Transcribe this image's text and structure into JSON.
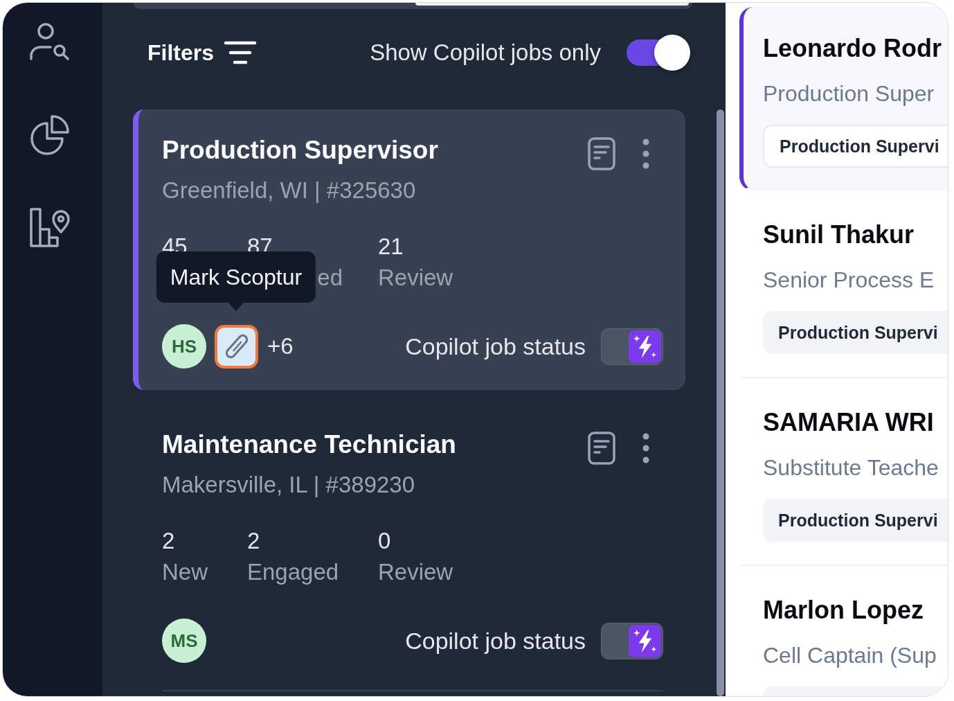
{
  "filters": {
    "label": "Filters",
    "copilot_only_label": "Show Copilot jobs only",
    "copilot_only": true
  },
  "jobs": [
    {
      "title": "Production Supervisor",
      "subtitle": "Greenfield, WI | #325630",
      "selected": true,
      "stats": [
        {
          "value": "45"
        },
        {
          "value": "87",
          "label": "ed",
          "covered": true
        },
        {
          "value": "21",
          "label": "Review"
        }
      ],
      "tooltip": "Mark Scoptur",
      "avatars": [
        {
          "kind": "initials",
          "initials": "HS"
        },
        {
          "kind": "attachment",
          "focused": true
        }
      ],
      "more": "+6",
      "copilot_label": "Copilot job status",
      "copilot_on": true
    },
    {
      "title": "Maintenance Technician",
      "subtitle": "Makersville, IL | #389230",
      "selected": false,
      "stats": [
        {
          "value": "2",
          "label": "New"
        },
        {
          "value": "2",
          "label": "Engaged"
        },
        {
          "value": "0",
          "label": "Review"
        }
      ],
      "avatars": [
        {
          "kind": "initials",
          "initials": "MS"
        }
      ],
      "copilot_label": "Copilot job status",
      "copilot_on": true
    }
  ],
  "candidates": [
    {
      "name": "Leonardo Rodr",
      "title": "Production Super",
      "has_tag": true,
      "tag": "Production Supervi",
      "selected": true
    },
    {
      "name": "Sunil Thakur",
      "title": "Senior Process E",
      "has_tag": true,
      "tag": "Production Supervi",
      "selected": false
    },
    {
      "name": "SAMARIA WRI",
      "title": "Substitute Teache",
      "has_tag": true,
      "tag": "Production Supervi",
      "selected": false
    },
    {
      "name": "Marlon Lopez",
      "title": "Cell Captain (Sup",
      "has_tag": true,
      "selected": false
    }
  ]
}
